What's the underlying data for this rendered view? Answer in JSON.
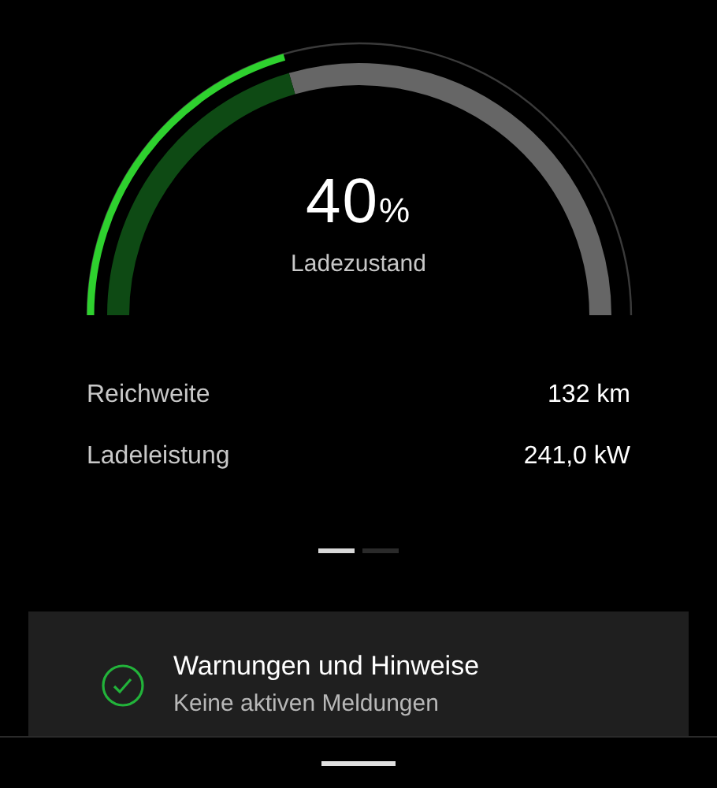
{
  "gauge": {
    "value": "40",
    "unit": "%",
    "label": "Ladezustand"
  },
  "stats": [
    {
      "label": "Reichweite",
      "value": "132 km"
    },
    {
      "label": "Ladeleistung",
      "value": "241,0 kW"
    }
  ],
  "pages": [
    {
      "selected": true
    },
    {
      "selected": false
    }
  ],
  "notice": {
    "kind": "ok",
    "title": "Warnungen und Hinweise",
    "subtitle": "Keine aktiven Meldungen"
  }
}
